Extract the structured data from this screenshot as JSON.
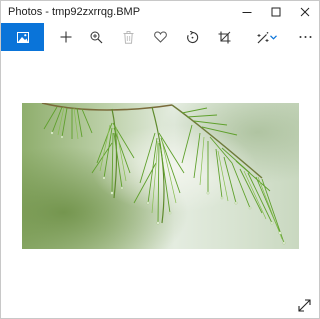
{
  "window": {
    "title": "Photos - tmp92zxrrqg.BMP"
  },
  "titlebar_buttons": {
    "minimize_icon": "minimize-icon",
    "maximize_icon": "maximize-icon",
    "close_icon": "close-icon"
  },
  "toolbar": {
    "accent_color": "#0a74d9",
    "items": [
      {
        "name": "view-image-button",
        "icon": "image-icon"
      },
      {
        "name": "add-button",
        "icon": "plus-icon"
      },
      {
        "name": "zoom-button",
        "icon": "zoom-in-icon"
      },
      {
        "name": "delete-button",
        "icon": "trash-icon"
      },
      {
        "name": "favorite-button",
        "icon": "heart-icon"
      },
      {
        "name": "rotate-button",
        "icon": "rotate-icon"
      },
      {
        "name": "crop-button",
        "icon": "crop-icon"
      },
      {
        "name": "enhance-button",
        "icon": "magic-wand-icon"
      },
      {
        "name": "enhance-dropdown",
        "icon": "chevron-down-icon"
      },
      {
        "name": "more-button",
        "icon": "more-icon"
      }
    ]
  },
  "image": {
    "subject": "pine-branch-photo"
  },
  "fullscreen": {
    "icon": "fullscreen-icon"
  }
}
